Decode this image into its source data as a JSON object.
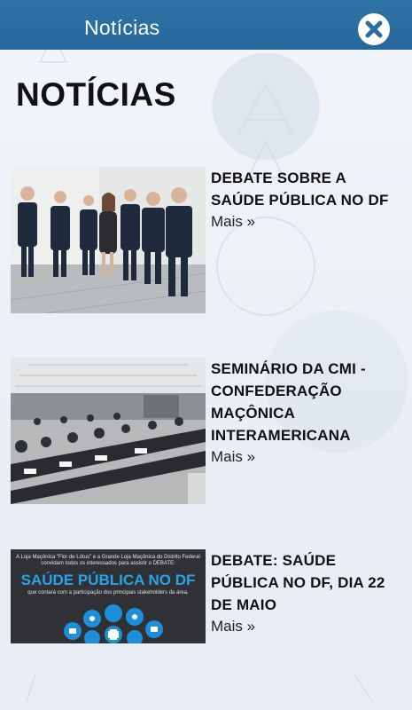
{
  "app": {
    "title": "Notícias",
    "close_icon": "close-icon"
  },
  "page": {
    "heading": "NOTÍCIAS"
  },
  "news": [
    {
      "title": "DEBATE SOBRE A SAÚDE PÚBLICA NO DF",
      "more": "Mais »",
      "image": "group-photo-debate"
    },
    {
      "title": "SEMINÁRIO DA CMI - CONFEDERAÇÃO MAÇÔNICA INTERAMERICANA",
      "more": "Mais »",
      "image": "conference-room-photo"
    },
    {
      "title": "DEBATE: SAÚDE PÚBLICA NO DF, DIA 22 DE MAIO",
      "more": "Mais »",
      "image": "event-banner",
      "banner": {
        "intro": "A Loja Maçônica \"Flor de Lótus\" e a Grande Loja Maçônica do Distrito Federal convidam todos os interessados para assistir o DEBATE:",
        "headline": "SAÚDE PÚBLICA NO DF",
        "sub": "que contará com a participação dos principais stakeholders da área."
      }
    }
  ],
  "colors": {
    "topbar": "#2a6ea0",
    "banner_blue": "#1d8fd8",
    "text": "#111111"
  }
}
